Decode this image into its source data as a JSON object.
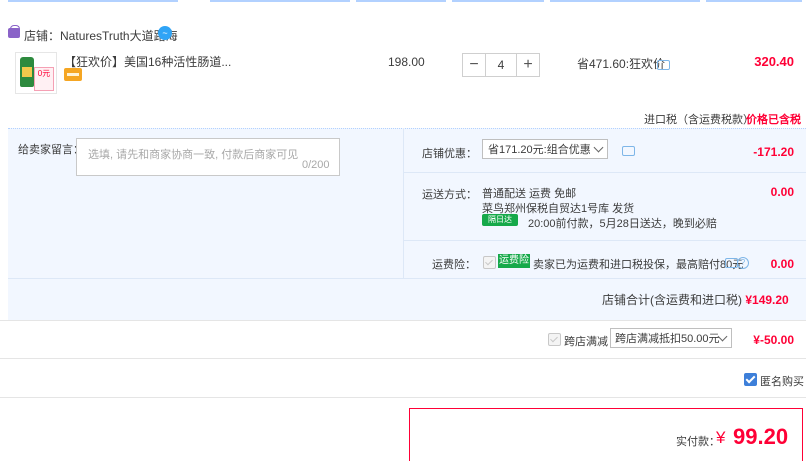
{
  "shop": {
    "label": "店铺：",
    "name": "NaturesTruth大道路海"
  },
  "item": {
    "title": "【狂欢价】美国16种活性肠道...",
    "thumb_tag": "0元",
    "unit_price": "198.00",
    "quantity": "4",
    "qty_minus": "−",
    "qty_plus": "+",
    "promo_saving": "省471.60:狂欢价",
    "total": "320.40"
  },
  "import_tax": {
    "label": "进口税（含运费税款）",
    "value": "价格已含税"
  },
  "message": {
    "label": "给卖家留言：",
    "placeholder": "选填, 请先和商家协商一致, 付款后商家可见",
    "counter": "0/200"
  },
  "shop_discount": {
    "label": "店铺优惠：",
    "selected": "省171.20元:组合优惠",
    "amount": "-171.20"
  },
  "shipping": {
    "label": "运送方式：",
    "line1": "普通配送 运费 免邮",
    "line2": "菜鸟郑州保税自贸达1号库  发货",
    "badge": "隔日达",
    "line3": "20:00前付款，5月28日送达，晚到必赔",
    "amount": "0.00"
  },
  "insurance": {
    "label": "运费险：",
    "badge": "运费险",
    "text": "卖家已为运费和进口税投保，最高赔付80元",
    "amount": "0.00"
  },
  "shop_total": {
    "label": "店铺合计(含运费和进口税)",
    "value": "¥149.20"
  },
  "cross_store": {
    "label": "跨店满减",
    "selected": "跨店满减抵扣50.00元",
    "amount": "¥-50.00"
  },
  "anonymous": {
    "label": "匿名购买",
    "checked": true
  },
  "payment": {
    "label": "实付款：",
    "currency": "¥",
    "amount": "99.20"
  },
  "colors": {
    "accent_red": "#ff0036",
    "panel_bg": "#f2f7ff",
    "green": "#16a94a",
    "link_blue": "#3d7fd9"
  }
}
